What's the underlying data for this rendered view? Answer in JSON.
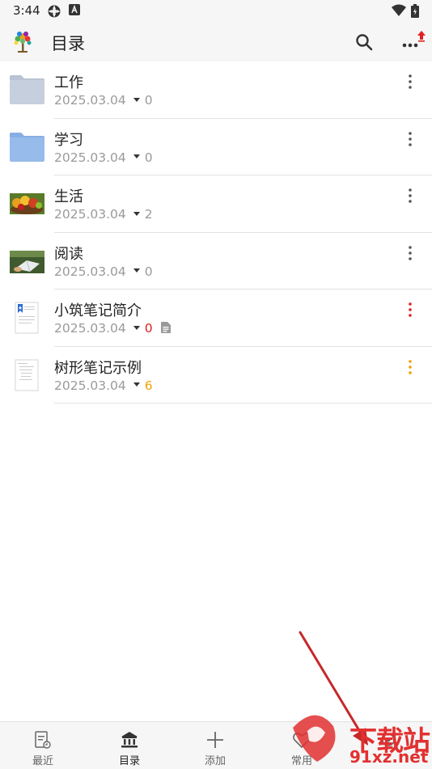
{
  "status_bar": {
    "time": "3:44"
  },
  "app_bar": {
    "title": "目录"
  },
  "items": [
    {
      "title": "工作",
      "date": "2025.03.04",
      "count": "0",
      "count_color": "#9a9a9a",
      "more_color": "#555555",
      "thumb": "folder-gray-icon"
    },
    {
      "title": "学习",
      "date": "2025.03.04",
      "count": "0",
      "count_color": "#9a9a9a",
      "more_color": "#555555",
      "thumb": "folder-blue-icon"
    },
    {
      "title": "生活",
      "date": "2025.03.04",
      "count": "2",
      "count_color": "#9a9a9a",
      "more_color": "#555555",
      "thumb": "fruit-photo"
    },
    {
      "title": "阅读",
      "date": "2025.03.04",
      "count": "0",
      "count_color": "#9a9a9a",
      "more_color": "#555555",
      "thumb": "reading-photo"
    },
    {
      "title": "小筑笔记简介",
      "date": "2025.03.04",
      "count": "0",
      "count_color": "#e02020",
      "more_color": "#e02020",
      "thumb": "bookmark-document-icon",
      "has_note_icon": true
    },
    {
      "title": "树形笔记示例",
      "date": "2025.03.04",
      "count": "6",
      "count_color": "#f0a000",
      "more_color": "#f0a000",
      "thumb": "document-icon"
    }
  ],
  "bottom_nav": [
    {
      "label": "最近",
      "icon": "recent-notes-icon"
    },
    {
      "label": "目录",
      "icon": "library-icon",
      "active": true
    },
    {
      "label": "添加",
      "icon": "plus-icon"
    },
    {
      "label": "常用",
      "icon": "heart-icon"
    },
    {
      "label": "",
      "icon": "settings-icon"
    }
  ],
  "watermark": {
    "line1": "下载站",
    "line2": "91xz.net"
  }
}
